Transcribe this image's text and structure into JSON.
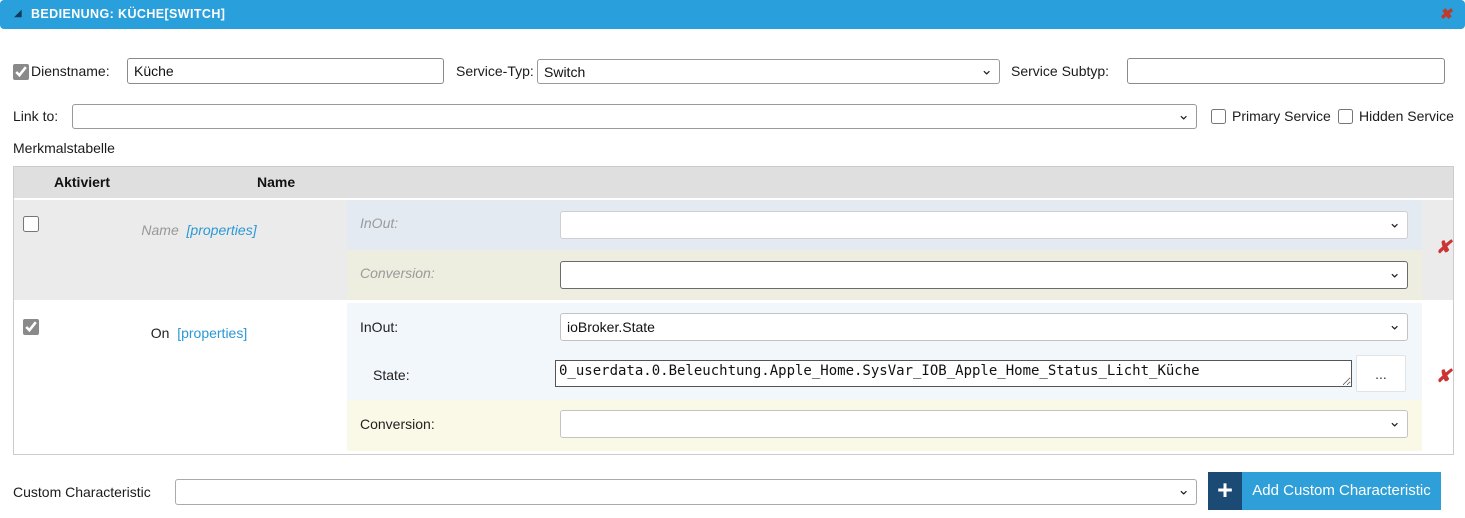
{
  "panel": {
    "title": "BEDIENUNG: KÜCHE[SWITCH]"
  },
  "icons": {
    "collapse": "◢",
    "close": "✖",
    "delete": "✘",
    "chevron": "⌄",
    "plus": "+",
    "ellipsis": "..."
  },
  "form": {
    "dienstname_label": "Dienstname:",
    "dienstname_value": "Küche",
    "dienstname_checked": true,
    "service_typ_label": "Service-Typ:",
    "service_typ_value": "Switch",
    "service_subtyp_label": "Service Subtyp:",
    "service_subtyp_value": "",
    "link_to_label": "Link to:",
    "link_to_value": "",
    "primary_service_label": "Primary Service",
    "primary_service_checked": false,
    "hidden_service_label": "Hidden Service",
    "hidden_service_checked": false
  },
  "table": {
    "caption": "Merkmalstabelle",
    "header_aktiviert": "Aktiviert",
    "header_name": "Name",
    "rows": [
      {
        "enabled": false,
        "name": "Name",
        "properties": "[properties]",
        "inout_label": "InOut:",
        "inout_value": "",
        "conversion_label": "Conversion:",
        "conversion_value": ""
      },
      {
        "enabled": true,
        "name": "On",
        "properties": "[properties]",
        "inout_label": "InOut:",
        "inout_value": "ioBroker.State",
        "state_label": "State:",
        "state_value": "0_userdata.0.Beleuchtung.Apple_Home.SysVar_IOB_Apple_Home_Status_Licht_Küche",
        "conversion_label": "Conversion:",
        "conversion_value": ""
      }
    ]
  },
  "footer": {
    "custom_characteristic_label": "Custom Characteristic",
    "custom_characteristic_value": "",
    "add_button_label": "Add Custom Characteristic"
  },
  "colors": {
    "header_bg": "#29A0DB",
    "accent_blue": "#2E9FD9",
    "navy": "#1B4A74",
    "danger_red": "#CC3333",
    "link_blue": "#2B98D5",
    "row_disabled_bg": "#EBEBEB",
    "cell_blue": "#F2F7FC",
    "cell_yellow": "#FAF9E8"
  }
}
